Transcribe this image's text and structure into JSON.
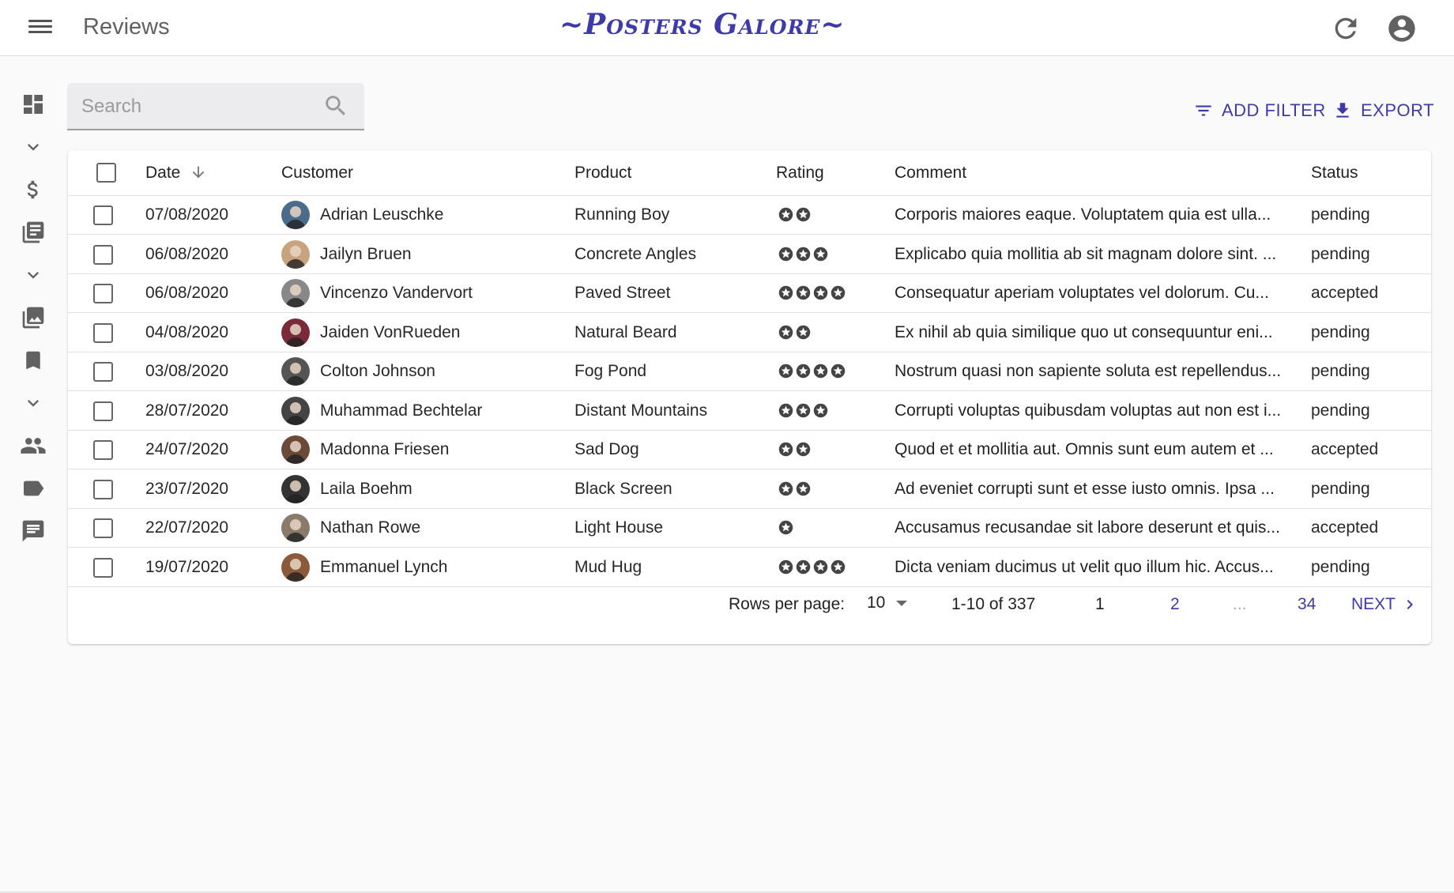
{
  "appbar": {
    "title": "Reviews",
    "brand": "~Posters Galore~",
    "menu_icon": "menu-icon",
    "refresh_icon": "refresh-icon",
    "account_icon": "account-circle-icon"
  },
  "sidebar": {
    "items": [
      {
        "icon": "dashboard-icon"
      },
      {
        "icon": "chevron-down-icon"
      },
      {
        "icon": "dollar-icon"
      },
      {
        "icon": "receipt-list-icon"
      },
      {
        "icon": "chevron-down-icon"
      },
      {
        "icon": "photo-library-icon"
      },
      {
        "icon": "bookmark-icon"
      },
      {
        "icon": "chevron-down-icon"
      },
      {
        "icon": "people-icon"
      },
      {
        "icon": "label-tag-icon"
      },
      {
        "icon": "comment-icon"
      }
    ]
  },
  "search": {
    "placeholder": "Search",
    "value": ""
  },
  "actions": {
    "add_filter": "ADD FILTER",
    "export": "EXPORT"
  },
  "accent_color": "#3f3aa9",
  "table": {
    "headers": {
      "date": "Date",
      "customer": "Customer",
      "product": "Product",
      "rating": "Rating",
      "comment": "Comment",
      "status": "Status"
    },
    "sort": {
      "column": "Date",
      "direction": "descending"
    },
    "rows": [
      {
        "date": "07/08/2020",
        "customer": "Adrian Leuschke",
        "product": "Running Boy",
        "rating": 2,
        "comment": "Corporis maiores eaque. Voluptatem quia est ulla...",
        "status": "pending"
      },
      {
        "date": "06/08/2020",
        "customer": "Jailyn Bruen",
        "product": "Concrete Angles",
        "rating": 3,
        "comment": "Explicabo quia mollitia ab sit magnam dolore sint. ...",
        "status": "pending"
      },
      {
        "date": "06/08/2020",
        "customer": "Vincenzo Vandervort",
        "product": "Paved Street",
        "rating": 4,
        "comment": "Consequatur aperiam voluptates vel dolorum. Cu...",
        "status": "accepted"
      },
      {
        "date": "04/08/2020",
        "customer": "Jaiden VonRueden",
        "product": "Natural Beard",
        "rating": 2,
        "comment": "Ex nihil ab quia similique quo ut consequuntur eni...",
        "status": "pending"
      },
      {
        "date": "03/08/2020",
        "customer": "Colton Johnson",
        "product": "Fog Pond",
        "rating": 4,
        "comment": "Nostrum quasi non sapiente soluta est repellendus...",
        "status": "pending"
      },
      {
        "date": "28/07/2020",
        "customer": "Muhammad Bechtelar",
        "product": "Distant Mountains",
        "rating": 3,
        "comment": "Corrupti voluptas quibusdam voluptas aut non est i...",
        "status": "pending"
      },
      {
        "date": "24/07/2020",
        "customer": "Madonna Friesen",
        "product": "Sad Dog",
        "rating": 2,
        "comment": "Quod et et mollitia aut. Omnis sunt eum autem et ...",
        "status": "accepted"
      },
      {
        "date": "23/07/2020",
        "customer": "Laila Boehm",
        "product": "Black Screen",
        "rating": 2,
        "comment": "Ad eveniet corrupti sunt et esse iusto omnis. Ipsa ...",
        "status": "pending"
      },
      {
        "date": "22/07/2020",
        "customer": "Nathan Rowe",
        "product": "Light House",
        "rating": 1,
        "comment": "Accusamus recusandae sit labore deserunt et quis...",
        "status": "accepted"
      },
      {
        "date": "19/07/2020",
        "customer": "Emmanuel Lynch",
        "product": "Mud Hug",
        "rating": 4,
        "comment": "Dicta veniam ducimus ut velit quo illum hic. Accus...",
        "status": "pending"
      }
    ]
  },
  "pagination": {
    "rows_per_page_label": "Rows per page:",
    "rows_per_page": "10",
    "range": "1-10 of 337",
    "current_page": "1",
    "page_2": "2",
    "ellipsis": "...",
    "last_page": "34",
    "next": "NEXT"
  }
}
